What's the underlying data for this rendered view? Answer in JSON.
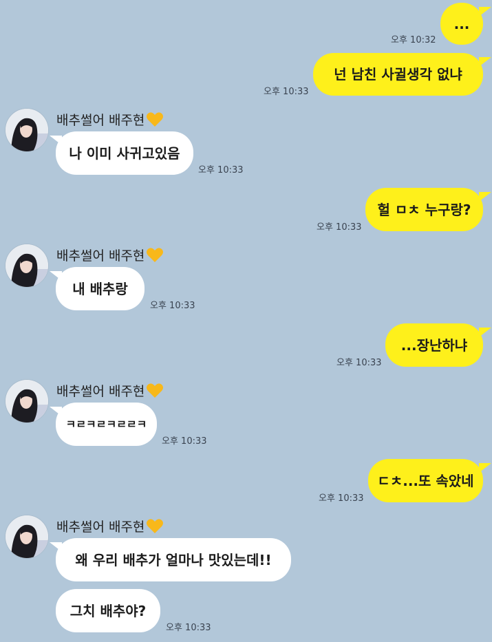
{
  "colors": {
    "background": "#b2c7d9",
    "my_bubble": "#fef01b",
    "their_bubble": "#ffffff",
    "heart": "#f8b81a"
  },
  "sender": {
    "name": "배추썰어 배주현",
    "heart_icon": "yellow-heart-icon"
  },
  "messages": [
    {
      "from": "me",
      "text": "...",
      "time": "오후 10:32"
    },
    {
      "from": "me",
      "text": "넌 남친 사귈생각 없냐",
      "time": "오후 10:33"
    },
    {
      "from": "other",
      "text": "나 이미 사귀고있음",
      "time": "오후 10:33"
    },
    {
      "from": "me",
      "text": "헐 ㅁㅊ 누구랑?",
      "time": "오후 10:33"
    },
    {
      "from": "other",
      "text": "내 배추랑",
      "time": "오후 10:33"
    },
    {
      "from": "me",
      "text": "...장난하냐",
      "time": "오후 10:33"
    },
    {
      "from": "other",
      "text": "ㅋㄹㅋㄹㅋㄹㄹㅋ",
      "time": "오후 10:33"
    },
    {
      "from": "me",
      "text": "ㄷㅊ...또 속았네",
      "time": "오후 10:33"
    },
    {
      "from": "other",
      "text": "왜 우리 배추가 얼마나 맛있는데!!",
      "time": ""
    },
    {
      "from": "other",
      "text": "그치 배추야?",
      "time": "오후 10:33"
    }
  ]
}
